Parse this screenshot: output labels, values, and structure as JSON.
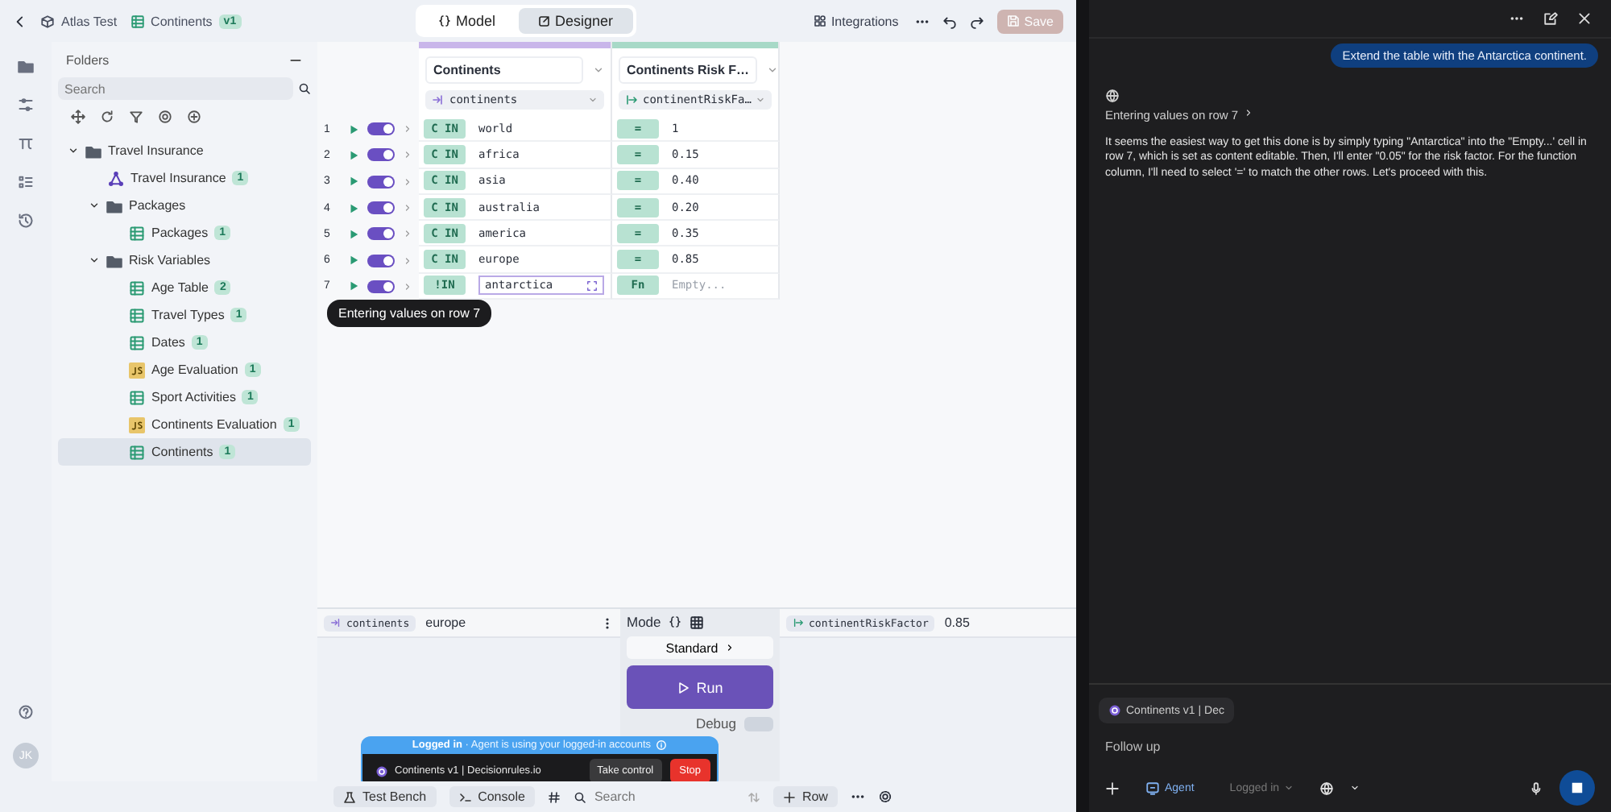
{
  "topbar": {
    "breadcrumb": [
      {
        "kind": "project",
        "label": "Atlas Test"
      },
      {
        "kind": "table",
        "label": "Continents",
        "badge": "v1"
      }
    ],
    "views": [
      {
        "label": "Model",
        "kind": "braces",
        "selected": false
      },
      {
        "label": "Designer",
        "kind": "edit",
        "selected": true
      }
    ],
    "integrations": "Integrations",
    "save": {
      "label": "Save",
      "disabled": true
    }
  },
  "rail": {
    "avatar": "JK"
  },
  "folders": {
    "title": "Folders",
    "search_placeholder": "Search",
    "tree": [
      {
        "kind": "folder",
        "label": "Travel Insurance",
        "expanded": true,
        "children": [
          {
            "kind": "flow",
            "label": "Travel Insurance",
            "badge": "1",
            "selected": false
          },
          {
            "kind": "folder",
            "label": "Packages",
            "expanded": true,
            "children": [
              {
                "kind": "table",
                "label": "Packages",
                "badge": "1",
                "selected": false
              }
            ]
          },
          {
            "kind": "folder",
            "label": "Risk Variables",
            "expanded": true,
            "children": [
              {
                "kind": "table",
                "label": "Age Table",
                "badge": "2",
                "selected": false
              },
              {
                "kind": "table",
                "label": "Travel Types",
                "badge": "1",
                "selected": false
              },
              {
                "kind": "table",
                "label": "Dates",
                "badge": "1",
                "selected": false
              },
              {
                "kind": "js",
                "label": "Age Evaluation",
                "badge": "1",
                "selected": false
              },
              {
                "kind": "table",
                "label": "Sport Activities",
                "badge": "1",
                "selected": false
              },
              {
                "kind": "js",
                "label": "Continents Evaluation",
                "badge": "1",
                "selected": false
              },
              {
                "kind": "table",
                "label": "Continents",
                "badge": "1",
                "selected": true
              }
            ]
          }
        ]
      }
    ]
  },
  "table": {
    "columns": [
      {
        "kind": "input",
        "title": "Continents",
        "variable": "continents"
      },
      {
        "kind": "output",
        "title": "Continents Risk F…",
        "variable": "continentRiskFa…"
      }
    ],
    "rows": [
      {
        "number": "1",
        "enabled": true,
        "editing": false,
        "condition": {
          "operator": "C IN",
          "value": "world"
        },
        "result": {
          "operator": "=",
          "value": "1"
        }
      },
      {
        "number": "2",
        "enabled": true,
        "editing": false,
        "condition": {
          "operator": "C IN",
          "value": "africa"
        },
        "result": {
          "operator": "=",
          "value": "0.15"
        }
      },
      {
        "number": "3",
        "enabled": true,
        "editing": false,
        "condition": {
          "operator": "C IN",
          "value": "asia"
        },
        "result": {
          "operator": "=",
          "value": "0.40"
        }
      },
      {
        "number": "4",
        "enabled": true,
        "editing": false,
        "condition": {
          "operator": "C IN",
          "value": "australia"
        },
        "result": {
          "operator": "=",
          "value": "0.20"
        }
      },
      {
        "number": "5",
        "enabled": true,
        "editing": false,
        "condition": {
          "operator": "C IN",
          "value": "america"
        },
        "result": {
          "operator": "=",
          "value": "0.35"
        }
      },
      {
        "number": "6",
        "enabled": true,
        "editing": false,
        "condition": {
          "operator": "C IN",
          "value": "europe"
        },
        "result": {
          "operator": "=",
          "value": "0.85"
        }
      },
      {
        "number": "7",
        "enabled": true,
        "editing": true,
        "condition": {
          "operator": "!IN",
          "value": "antarctica"
        },
        "result": {
          "operator": "Fn",
          "placeholder": "Empty..."
        }
      }
    ],
    "tooltip": "Entering values on row 7"
  },
  "test_bench": {
    "input": {
      "variable": "continents",
      "value": "europe"
    },
    "mode": "Mode",
    "standard": "Standard",
    "run": "Run",
    "debug": {
      "label": "Debug",
      "on": false
    },
    "output": {
      "variable": "continentRiskFactor",
      "value": "0.85"
    }
  },
  "bottom_bar": {
    "test_bench": "Test Bench",
    "console": "Console",
    "search_placeholder": "Search",
    "add_row": "Row"
  },
  "agent_banner": {
    "title": "Logged in",
    "subtitle": "· Agent is using your logged-in accounts",
    "tab": "Continents v1 | Decisionrules.io",
    "take_control": "Take control",
    "stop": "Stop"
  },
  "chat": {
    "user_message": "Extend the table with the Antarctica continent.",
    "step": "Entering values on row 7",
    "reply": "It seems the easiest way to get this done is by simply typing \"Antarctica\" into the \"Empty...' cell in row 7, which is set as content editable. Then, I'll enter \"0.05\" for the risk factor. For the function column, I'll need to select '=' to match the other rows. Let's proceed with this.",
    "context_chip": "Continents v1 | Dec",
    "placeholder": "Follow up",
    "mode": "Agent",
    "login": "Logged in"
  }
}
